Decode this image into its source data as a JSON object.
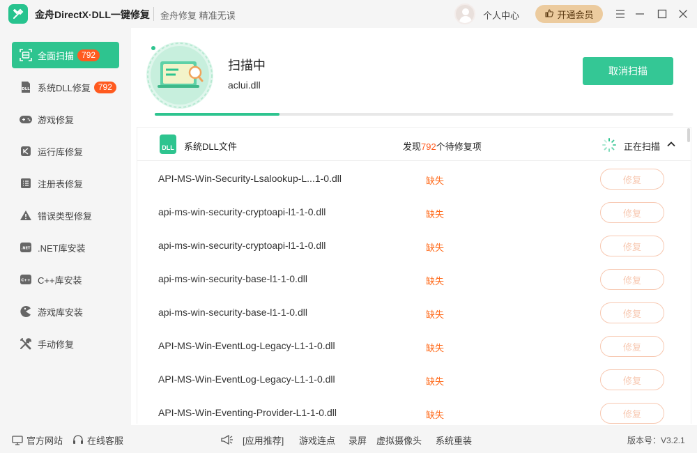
{
  "app": {
    "title": "金舟DirectX·DLL一键修复",
    "slogan": "金舟修复 精准无误",
    "user_center": "个人中心",
    "vip_label": "开通会员"
  },
  "sidebar": {
    "items": [
      {
        "label": "全面扫描",
        "badge": "792",
        "icon": "full-scan-icon",
        "active": true
      },
      {
        "label": "系统DLL修复",
        "badge": "792",
        "icon": "dll-icon"
      },
      {
        "label": "游戏修复",
        "icon": "gamepad-icon"
      },
      {
        "label": "运行库修复",
        "icon": "runtime-icon"
      },
      {
        "label": "注册表修复",
        "icon": "registry-icon"
      },
      {
        "label": "错误类型修复",
        "icon": "warning-icon"
      },
      {
        "label": ".NET库安装",
        "icon": "dotnet-icon"
      },
      {
        "label": "C++库安装",
        "icon": "cpp-icon"
      },
      {
        "label": "游戏库安装",
        "icon": "pacman-icon"
      },
      {
        "label": "手动修复",
        "icon": "tools-icon"
      }
    ]
  },
  "scan": {
    "status": "扫描中",
    "current_file": "aclui.dll",
    "cancel_label": "取消扫描",
    "progress": 0.24
  },
  "list": {
    "title": "系统DLL文件",
    "found_prefix": "发现",
    "found_count": "792",
    "found_suffix": "个待修复项",
    "scanning_label": "正在扫描",
    "rows": [
      {
        "name": "API-MS-Win-Security-Lsalookup-L...1-0.dll",
        "status": "缺失",
        "action": "修复"
      },
      {
        "name": "api-ms-win-security-cryptoapi-l1-1-0.dll",
        "status": "缺失",
        "action": "修复"
      },
      {
        "name": "api-ms-win-security-cryptoapi-l1-1-0.dll",
        "status": "缺失",
        "action": "修复"
      },
      {
        "name": "api-ms-win-security-base-l1-1-0.dll",
        "status": "缺失",
        "action": "修复"
      },
      {
        "name": "api-ms-win-security-base-l1-1-0.dll",
        "status": "缺失",
        "action": "修复"
      },
      {
        "name": "API-MS-Win-EventLog-Legacy-L1-1-0.dll",
        "status": "缺失",
        "action": "修复"
      },
      {
        "name": "API-MS-Win-EventLog-Legacy-L1-1-0.dll",
        "status": "缺失",
        "action": "修复"
      },
      {
        "name": "API-MS-Win-Eventing-Provider-L1-1-0.dll",
        "status": "缺失",
        "action": "修复"
      }
    ]
  },
  "footer": {
    "official_site": "官方网站",
    "online_service": "在线客服",
    "recommend": "[应用推荐]",
    "links": [
      "游戏连点",
      "录屏",
      "虚拟摄像头",
      "系统重装"
    ],
    "version": "版本号：V3.2.1"
  },
  "colors": {
    "accent": "#2ec48f",
    "badge": "#ff5a1f",
    "missing": "#ff6a1a",
    "vip": "#eccb9e"
  }
}
